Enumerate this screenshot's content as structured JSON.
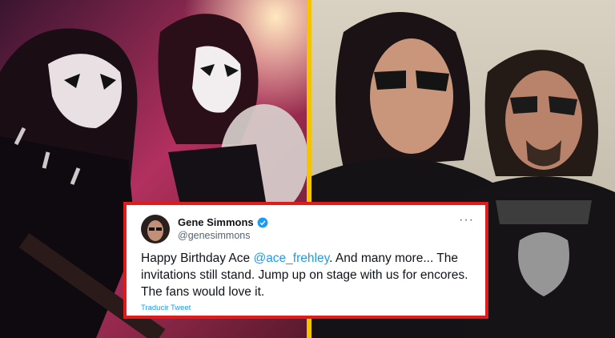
{
  "colors": {
    "border": "#e01b1b",
    "link": "#1d9bf0",
    "divider": "#f5c400",
    "text": "#0f1419",
    "muted": "#536471"
  },
  "left_photo": {
    "description_icon": "concert-photo"
  },
  "right_photo": {
    "description_icon": "portrait-photo"
  },
  "tweet": {
    "display_name": "Gene Simmons",
    "verified_icon": "verified-badge-icon",
    "handle": "@genesimmons",
    "more_icon": "···",
    "text_before": "Happy Birthday Ace ",
    "mention": "@ace_frehley",
    "text_after": ". And many more... The invitations still stand. Jump up on stage with us for encores. The fans would love it.",
    "translate_label": "Traducir Tweet"
  }
}
